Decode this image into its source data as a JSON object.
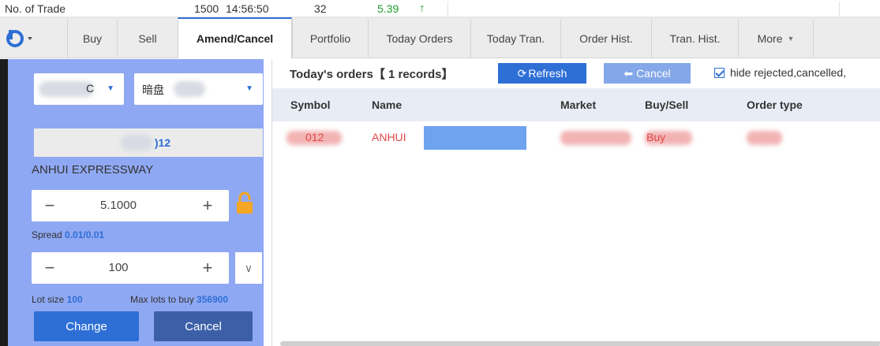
{
  "infobar": {
    "label": "No. of Trade",
    "trades": "1500",
    "time": "14:56:50",
    "count": "32",
    "price": "5.39",
    "arrow": "↑"
  },
  "nav": {
    "logo_icon": "broker-logo-icon",
    "tabs": [
      {
        "label": "Buy"
      },
      {
        "label": "Sell"
      },
      {
        "label": "Amend/Cancel"
      },
      {
        "label": "Portfolio"
      },
      {
        "label": "Today Orders"
      },
      {
        "label": "Today Tran."
      },
      {
        "label": "Order Hist."
      },
      {
        "label": "Tran. Hist."
      },
      {
        "label": "More"
      }
    ]
  },
  "panel": {
    "account_select_value": "C",
    "session_select_value": "暗盘",
    "code_value": ")12",
    "stock_name": "ANHUI EXPRESSWAY",
    "price": "5.1000",
    "spread_label": "Spread",
    "spread_value": "0.01/0.01",
    "quantity": "100",
    "lot_label": "Lot size",
    "lot_value": "100",
    "max_label": "Max lots to buy",
    "max_value": "356900",
    "change_label": "Change",
    "cancel_label": "Cancel"
  },
  "orders": {
    "title": "Today's orders【 1 records】",
    "refresh_label": "Refresh",
    "cancel_label": "Cancel",
    "hide_label": "hide rejected,cancelled,",
    "columns": [
      "Symbol",
      "Name",
      "Market",
      "Buy/Sell",
      "Order type"
    ],
    "rows": [
      {
        "symbol": "012",
        "name": "ANHUI",
        "market": "",
        "side": "Buy",
        "type": ""
      }
    ]
  },
  "colors": {
    "accent": "#2e6fd6",
    "panel_bg": "#8fa8f3",
    "up": "#1f9d2e",
    "sell_red": "#e04848"
  }
}
